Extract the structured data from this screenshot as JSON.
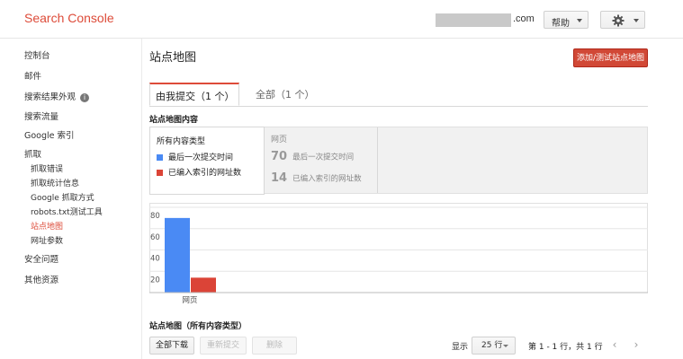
{
  "header": {
    "app_title": "Search Console",
    "domain_suffix": ".com",
    "help_label": "帮助"
  },
  "sidebar": {
    "items": [
      {
        "label": "控制台"
      },
      {
        "label": "邮件"
      },
      {
        "label": "搜索结果外观"
      },
      {
        "label": "搜索流量"
      },
      {
        "label": "Google 索引"
      },
      {
        "label": "抓取"
      },
      {
        "label": "抓取错误"
      },
      {
        "label": "抓取统计信息"
      },
      {
        "label": "Google 抓取方式"
      },
      {
        "label": "robots.txt测试工具"
      },
      {
        "label": "站点地图"
      },
      {
        "label": "网址参数"
      },
      {
        "label": "安全问题"
      },
      {
        "label": "其他资源"
      }
    ]
  },
  "main": {
    "title": "站点地图",
    "add_button": "添加/测试站点地图",
    "tabs": [
      {
        "label": "由我提交（1 个）"
      },
      {
        "label": "全部（1 个）"
      }
    ],
    "content_label": "站点地图内容",
    "legend": {
      "title": "所有内容类型",
      "items": [
        {
          "label": "最后一次提交时间",
          "color": "#4a8af4"
        },
        {
          "label": "已编入索引的网址数",
          "color": "#db4437"
        }
      ]
    },
    "summary": {
      "heading": "网页",
      "rows": [
        {
          "value": "70",
          "label": "最后一次提交时间"
        },
        {
          "value": "14",
          "label": "已编入索引的网址数"
        }
      ]
    },
    "table_label": "站点地图（所有内容类型）",
    "toolbar": {
      "download_all": "全部下载",
      "resubmit": "重新提交",
      "delete": "删除",
      "show_label": "显示",
      "rows_value": "25 行",
      "range_text": "第 1 - 1 行，共 1 行",
      "prev": "‹",
      "next": "›"
    }
  },
  "chart_data": {
    "type": "bar",
    "categories": [
      "网页"
    ],
    "series": [
      {
        "name": "最后一次提交时间",
        "values": [
          70
        ],
        "color": "#4a8af4"
      },
      {
        "name": "已编入索引的网址数",
        "values": [
          14
        ],
        "color": "#db4437"
      }
    ],
    "yticks": [
      20,
      40,
      60,
      80
    ],
    "ylim": [
      0,
      80
    ],
    "grid": true
  }
}
